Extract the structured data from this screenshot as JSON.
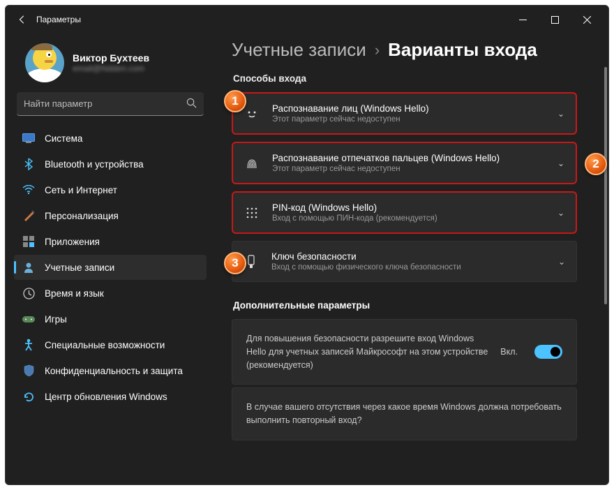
{
  "titlebar": {
    "title": "Параметры"
  },
  "user": {
    "name": "Виктор Бухтеев",
    "email": "email@hidden.com"
  },
  "search": {
    "placeholder": "Найти параметр"
  },
  "nav": [
    {
      "label": "Система",
      "icon": "system"
    },
    {
      "label": "Bluetooth и устройства",
      "icon": "bluetooth"
    },
    {
      "label": "Сеть и Интернет",
      "icon": "wifi"
    },
    {
      "label": "Персонализация",
      "icon": "brush"
    },
    {
      "label": "Приложения",
      "icon": "apps"
    },
    {
      "label": "Учетные записи",
      "icon": "account"
    },
    {
      "label": "Время и язык",
      "icon": "time"
    },
    {
      "label": "Игры",
      "icon": "games"
    },
    {
      "label": "Специальные возможности",
      "icon": "access"
    },
    {
      "label": "Конфиденциальность и защита",
      "icon": "privacy"
    },
    {
      "label": "Центр обновления Windows",
      "icon": "update"
    }
  ],
  "breadcrumb": {
    "parent": "Учетные записи",
    "current": "Варианты входа"
  },
  "section1": {
    "title": "Способы входа"
  },
  "cards": [
    {
      "title": "Распознавание лиц (Windows Hello)",
      "sub": "Этот параметр сейчас недоступен"
    },
    {
      "title": "Распознавание отпечатков пальцев (Windows Hello)",
      "sub": "Этот параметр сейчас недоступен"
    },
    {
      "title": "PIN-код (Windows Hello)",
      "sub": "Вход с помощью ПИН-кода (рекомендуется)"
    },
    {
      "title": "Ключ безопасности",
      "sub": "Вход с помощью физического ключа безопасности"
    }
  ],
  "section2": {
    "title": "Дополнительные параметры"
  },
  "extra": {
    "hello_text": "Для повышения безопасности разрешите вход Windows Hello для учетных записей Майкрософт на этом устройстве (рекомендуется)",
    "toggle_label": "Вкл.",
    "reauth_text": "В случае вашего отсутствия через какое время Windows должна потребовать выполнить повторный вход?"
  },
  "badges": {
    "b1": "1",
    "b2": "2",
    "b3": "3"
  }
}
